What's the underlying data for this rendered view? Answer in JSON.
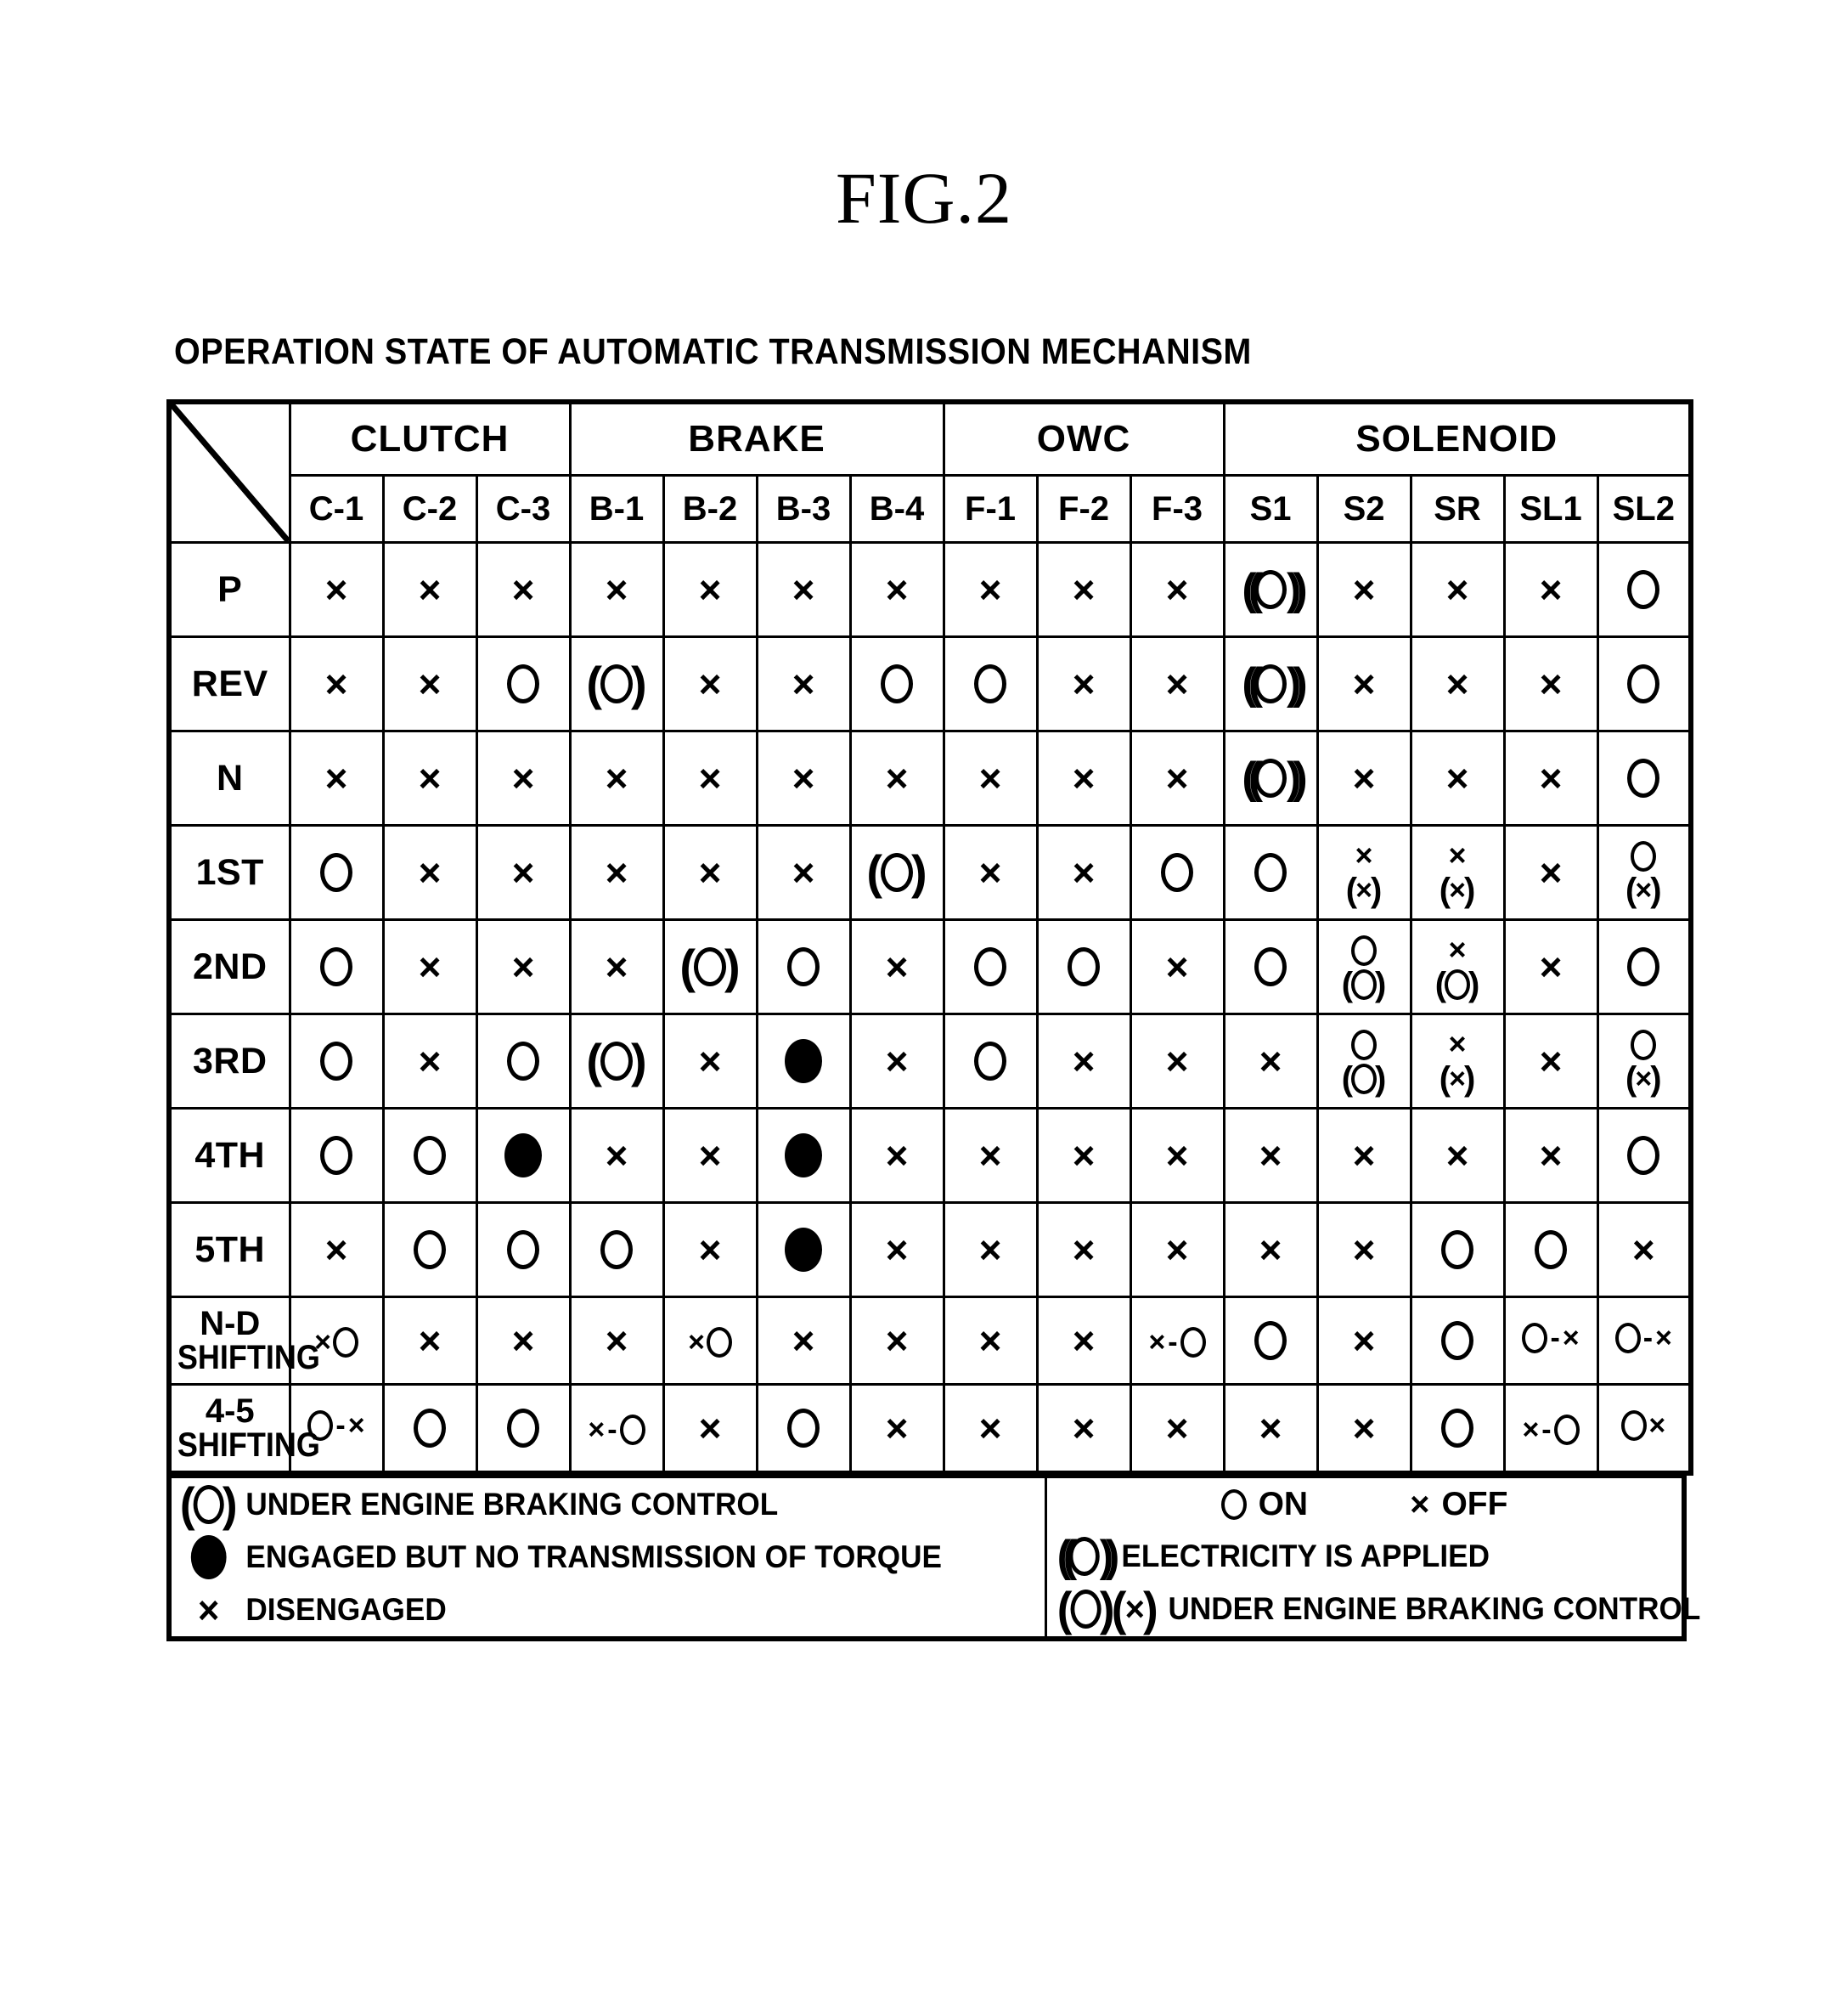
{
  "figure": {
    "label": "FIG.2",
    "caption": "OPERATION STATE OF AUTOMATIC TRANSMISSION MECHANISM"
  },
  "table": {
    "corner_icon": "diagonal-divider-icon",
    "groups": [
      {
        "label": "CLUTCH",
        "span": 3
      },
      {
        "label": "BRAKE",
        "span": 4
      },
      {
        "label": "OWC",
        "span": 3
      },
      {
        "label": "SOLENOID",
        "span": 5
      }
    ],
    "columns": [
      "C-1",
      "C-2",
      "C-3",
      "B-1",
      "B-2",
      "B-3",
      "B-4",
      "F-1",
      "F-2",
      "F-3",
      "S1",
      "S2",
      "SR",
      "SL1",
      "SL2"
    ],
    "rows": [
      {
        "label": "P",
        "label_line2": "",
        "cells": [
          "x",
          "x",
          "x",
          "x",
          "x",
          "x",
          "x",
          "x",
          "x",
          "x",
          "elec",
          "x",
          "x",
          "x",
          "o"
        ]
      },
      {
        "label": "REV",
        "label_line2": "",
        "cells": [
          "x",
          "x",
          "o",
          "paren-o",
          "x",
          "x",
          "o",
          "o",
          "x",
          "x",
          "elec",
          "x",
          "x",
          "x",
          "o"
        ]
      },
      {
        "label": "N",
        "label_line2": "",
        "cells": [
          "x",
          "x",
          "x",
          "x",
          "x",
          "x",
          "x",
          "x",
          "x",
          "x",
          "elec",
          "x",
          "x",
          "x",
          "o"
        ]
      },
      {
        "label": "1ST",
        "label_line2": "",
        "cells": [
          "o",
          "x",
          "x",
          "x",
          "x",
          "x",
          "paren-o",
          "x",
          "x",
          "o",
          "o",
          "stack-x-parenx",
          "stack-x-parenx",
          "x",
          "stack-o-parenx"
        ]
      },
      {
        "label": "2ND",
        "label_line2": "",
        "cells": [
          "o",
          "x",
          "x",
          "x",
          "paren-o",
          "o",
          "x",
          "o",
          "o",
          "x",
          "o",
          "stack-o-pareno",
          "stack-x-pareno",
          "x",
          "o"
        ]
      },
      {
        "label": "3RD",
        "label_line2": "",
        "cells": [
          "o",
          "x",
          "o",
          "paren-o",
          "x",
          "filled",
          "x",
          "o",
          "x",
          "x",
          "x",
          "stack-o-pareno",
          "stack-x-parenx",
          "x",
          "stack-o-parenx"
        ]
      },
      {
        "label": "4TH",
        "label_line2": "",
        "cells": [
          "o",
          "o",
          "filled",
          "x",
          "x",
          "filled",
          "x",
          "x",
          "x",
          "x",
          "x",
          "x",
          "x",
          "x",
          "o"
        ]
      },
      {
        "label": "5TH",
        "label_line2": "",
        "cells": [
          "x",
          "o",
          "o",
          "o",
          "x",
          "filled",
          "x",
          "x",
          "x",
          "x",
          "x",
          "x",
          "o",
          "o",
          "x"
        ]
      },
      {
        "label": "N-D",
        "label_line2": "SHIFTING",
        "cells": [
          "x-o",
          "x",
          "x",
          "x",
          "x-o",
          "x",
          "x",
          "x",
          "x",
          "x-dash-o",
          "o",
          "x",
          "o",
          "o-dash-x",
          "o-dash-x"
        ]
      },
      {
        "label": "4-5",
        "label_line2": "SHIFTING",
        "cells": [
          "o-dash-x",
          "o",
          "o",
          "x-dash-o",
          "x",
          "o",
          "x",
          "x",
          "x",
          "x",
          "x",
          "x",
          "o",
          "x-dash-o",
          "o-x"
        ]
      }
    ]
  },
  "legend": {
    "left": [
      {
        "symbol": "paren-o",
        "text": "UNDER ENGINE BRAKING CONTROL"
      },
      {
        "symbol": "filled",
        "text": "ENGAGED BUT NO TRANSMISSION OF TORQUE"
      },
      {
        "symbol": "x",
        "text": "DISENGAGED"
      }
    ],
    "right": {
      "on_label": "ON",
      "off_label": "OFF",
      "lines": [
        {
          "symbol": "elec",
          "text": "ELECTRICITY IS APPLIED"
        },
        {
          "symbol": "paren-o-paren-x",
          "text": "UNDER ENGINE BRAKING CONTROL"
        }
      ]
    }
  },
  "symbols": {
    "x": "×",
    "o": "circle-icon",
    "filled": "filled-circle-icon",
    "paren-o": "parenthesized-circle-icon",
    "elec": "electricity-applied-icon"
  }
}
